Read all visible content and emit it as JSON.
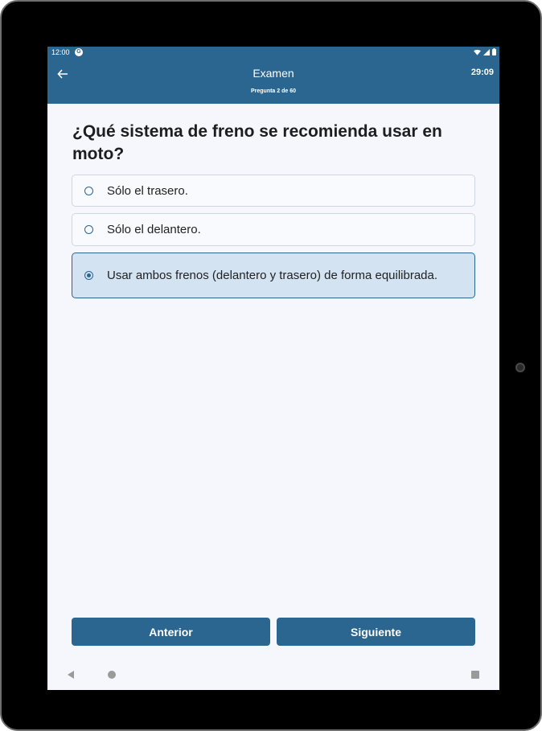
{
  "status_bar": {
    "time": "12:00",
    "notification_icon": "google-play-icon",
    "icons": [
      "wifi-icon",
      "signal-icon",
      "battery-icon"
    ]
  },
  "app_bar": {
    "title": "Examen",
    "subtitle": "Pregunta 2 de 60",
    "timer": "29:09",
    "back_icon": "arrow-left-icon"
  },
  "question": {
    "text": "¿Qué sistema de freno se recomienda usar en moto?"
  },
  "options": [
    {
      "label": "Sólo el trasero.",
      "selected": false
    },
    {
      "label": "Sólo el delantero.",
      "selected": false
    },
    {
      "label": "Usar ambos frenos (delantero y trasero) de forma equilibrada.",
      "selected": true
    }
  ],
  "buttons": {
    "previous": "Anterior",
    "next": "Siguiente"
  },
  "nav_bar": {
    "icons": [
      "back-triangle-icon",
      "home-circle-icon",
      "recents-square-icon"
    ]
  },
  "colors": {
    "primary": "#2b6690",
    "background": "#f5f7fc",
    "selected_option": "#d3e3f2"
  }
}
